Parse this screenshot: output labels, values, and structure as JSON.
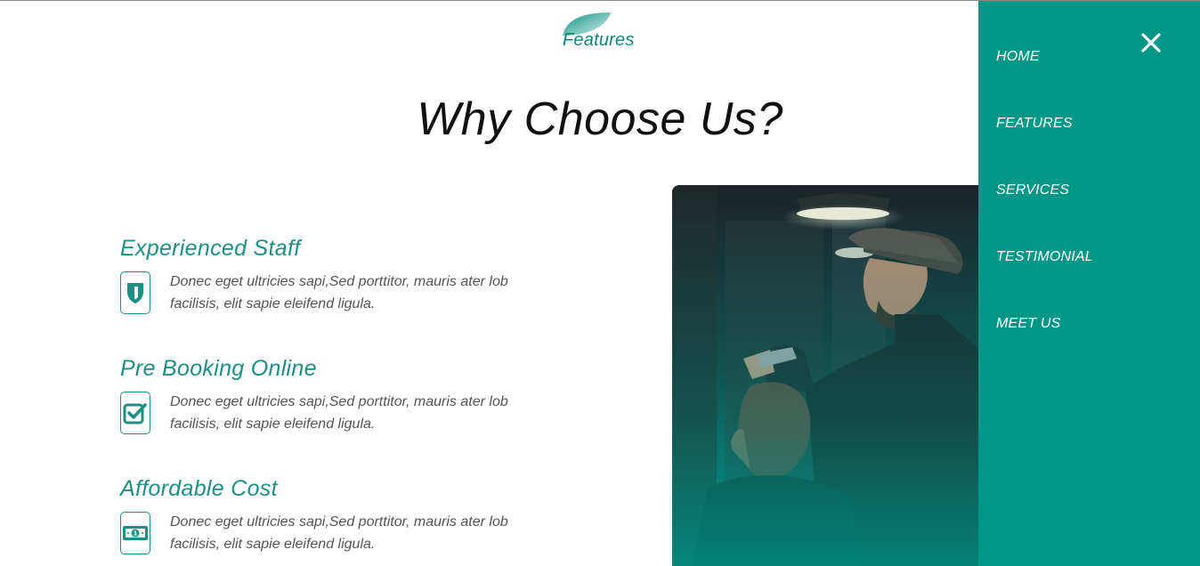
{
  "header": {
    "tag": "Features",
    "title": "Why Choose Us?"
  },
  "features": [
    {
      "title": "Experienced Staff",
      "icon": "shield-icon",
      "text": "Donec eget ultricies sapi,Sed porttitor, mauris ater lob facilisis, elit sapie eleifend ligula."
    },
    {
      "title": "Pre Booking Online",
      "icon": "checkbox-icon",
      "text": "Donec eget ultricies sapi,Sed porttitor, mauris ater lob facilisis, elit sapie eleifend ligula."
    },
    {
      "title": "Affordable Cost",
      "icon": "money-icon",
      "text": "Donec eget ultricies sapi,Sed porttitor, mauris ater lob facilisis, elit sapie eleifend ligula."
    }
  ],
  "sidenav": {
    "close_icon": "close-icon",
    "items": [
      {
        "label": "HOME"
      },
      {
        "label": "FEATURES"
      },
      {
        "label": "SERVICES"
      },
      {
        "label": "TESTIMONIAL"
      },
      {
        "label": "MEET US"
      }
    ]
  },
  "colors": {
    "accent": "#009688",
    "heading_accent": "#1d8f83",
    "text": "#555555",
    "title": "#111111"
  }
}
